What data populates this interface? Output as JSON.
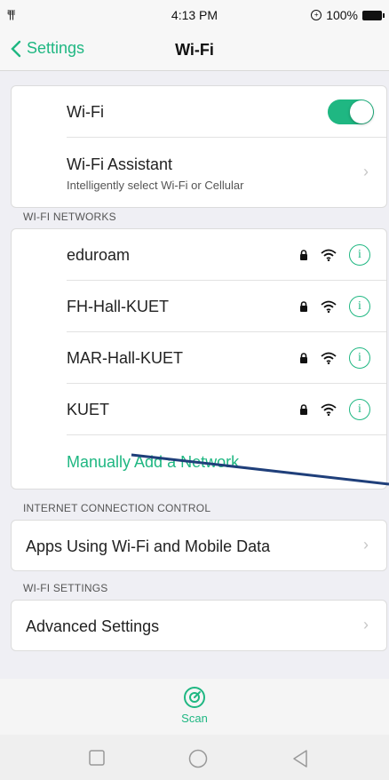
{
  "status": {
    "signal": "ⁱˡ|ˡ|ˡ",
    "time": "4:13 PM",
    "battery": "100%"
  },
  "nav": {
    "back": "Settings",
    "title": "Wi-Fi"
  },
  "wifi": {
    "label": "Wi-Fi",
    "enabled": true
  },
  "assistant": {
    "title": "Wi-Fi Assistant",
    "subtitle": "Intelligently select Wi-Fi or Cellular"
  },
  "networks_header": "WI-FI NETWORKS",
  "networks": [
    {
      "name": "eduroam"
    },
    {
      "name": "FH-Hall-KUET"
    },
    {
      "name": "MAR-Hall-KUET"
    },
    {
      "name": "KUET"
    }
  ],
  "manual_add": "Manually Add a Network",
  "icc_header": "INTERNET CONNECTION CONTROL",
  "apps_using": "Apps Using Wi-Fi and Mobile Data",
  "settings_header": "WI-FI SETTINGS",
  "advanced": "Advanced Settings",
  "scan_label": "Scan",
  "colors": {
    "accent": "#1fb782",
    "annotation_line": "#1f3f7a"
  }
}
